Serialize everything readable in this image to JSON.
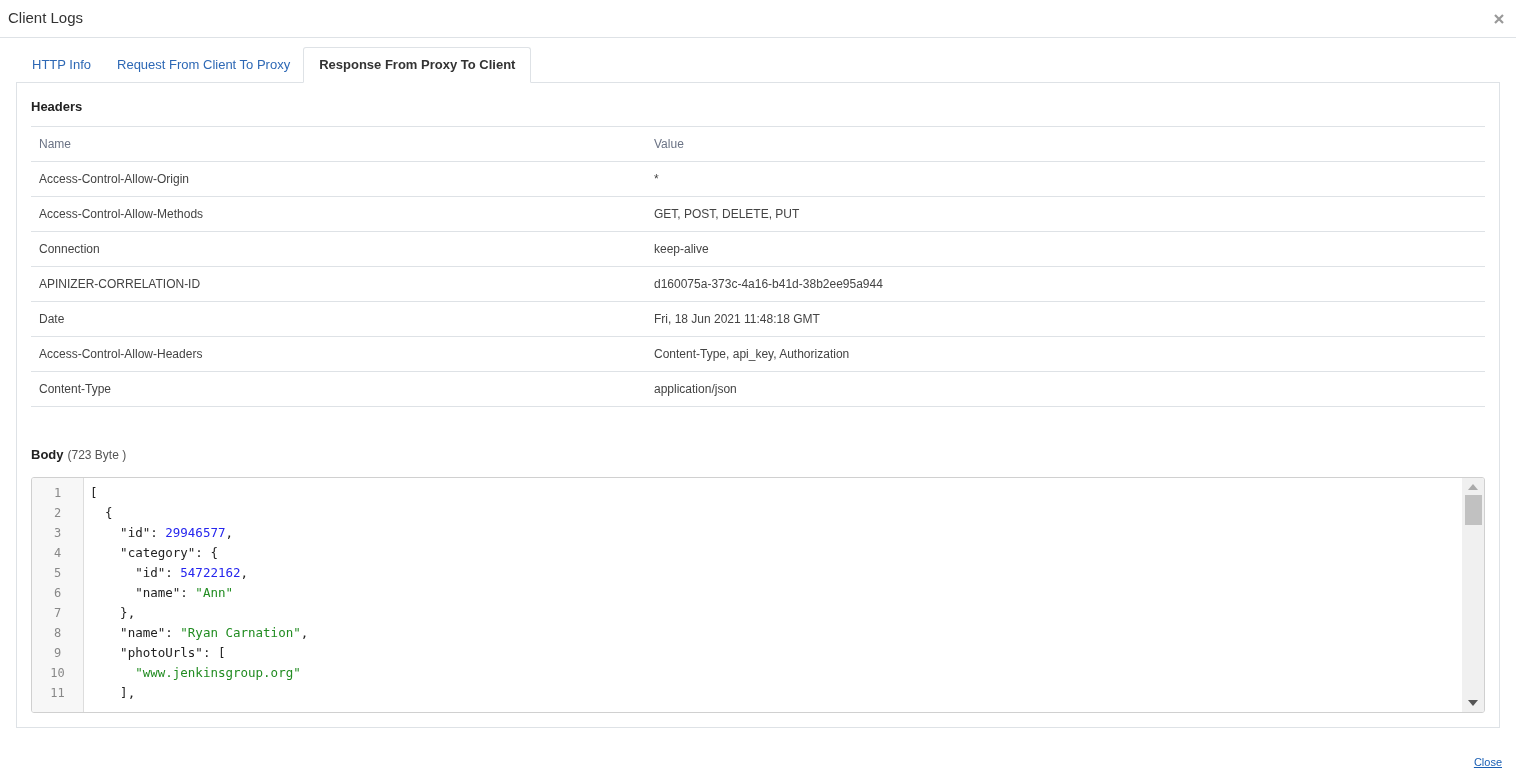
{
  "window": {
    "title": "Client Logs"
  },
  "tabs": [
    {
      "label": "HTTP Info",
      "selected": false
    },
    {
      "label": "Request From Client To Proxy",
      "selected": false
    },
    {
      "label": "Response From Proxy To Client",
      "selected": true
    }
  ],
  "headers": {
    "title": "Headers",
    "columns": [
      "Name",
      "Value"
    ],
    "rows": [
      [
        "Access-Control-Allow-Origin",
        "*"
      ],
      [
        "Access-Control-Allow-Methods",
        "GET, POST, DELETE, PUT"
      ],
      [
        "Connection",
        "keep-alive"
      ],
      [
        "APINIZER-CORRELATION-ID",
        "d160075a-373c-4a16-b41d-38b2ee95a944"
      ],
      [
        "Date",
        "Fri, 18 Jun 2021 11:48:18 GMT"
      ],
      [
        "Access-Control-Allow-Headers",
        "Content-Type, api_key, Authorization"
      ],
      [
        "Content-Type",
        "application/json"
      ]
    ]
  },
  "body": {
    "title": "Body",
    "size": "(723 Byte )",
    "lines": [
      {
        "number": "1",
        "segments": [
          {
            "kind": "plain",
            "text": "["
          }
        ]
      },
      {
        "number": "2",
        "segments": [
          {
            "kind": "plain",
            "text": "  {"
          }
        ]
      },
      {
        "number": "3",
        "segments": [
          {
            "kind": "plain",
            "text": "    \"id\": "
          },
          {
            "kind": "number",
            "text": "29946577"
          },
          {
            "kind": "plain",
            "text": ","
          }
        ]
      },
      {
        "number": "4",
        "segments": [
          {
            "kind": "plain",
            "text": "    \"category\": {"
          }
        ]
      },
      {
        "number": "5",
        "segments": [
          {
            "kind": "plain",
            "text": "      \"id\": "
          },
          {
            "kind": "number",
            "text": "54722162"
          },
          {
            "kind": "plain",
            "text": ","
          }
        ]
      },
      {
        "number": "6",
        "segments": [
          {
            "kind": "plain",
            "text": "      \"name\": "
          },
          {
            "kind": "string",
            "text": "\"Ann\""
          }
        ]
      },
      {
        "number": "7",
        "segments": [
          {
            "kind": "plain",
            "text": "    },"
          }
        ]
      },
      {
        "number": "8",
        "segments": [
          {
            "kind": "plain",
            "text": "    \"name\": "
          },
          {
            "kind": "string",
            "text": "\"Ryan Carnation\""
          },
          {
            "kind": "plain",
            "text": ","
          }
        ]
      },
      {
        "number": "9",
        "segments": [
          {
            "kind": "plain",
            "text": "    \"photoUrls\": ["
          }
        ]
      },
      {
        "number": "10",
        "segments": [
          {
            "kind": "string",
            "text": "      \"www.jenkinsgroup.org\""
          }
        ]
      },
      {
        "number": "11",
        "segments": [
          {
            "kind": "plain",
            "text": "    ],"
          }
        ]
      }
    ]
  },
  "footer": {
    "link": "Close"
  }
}
